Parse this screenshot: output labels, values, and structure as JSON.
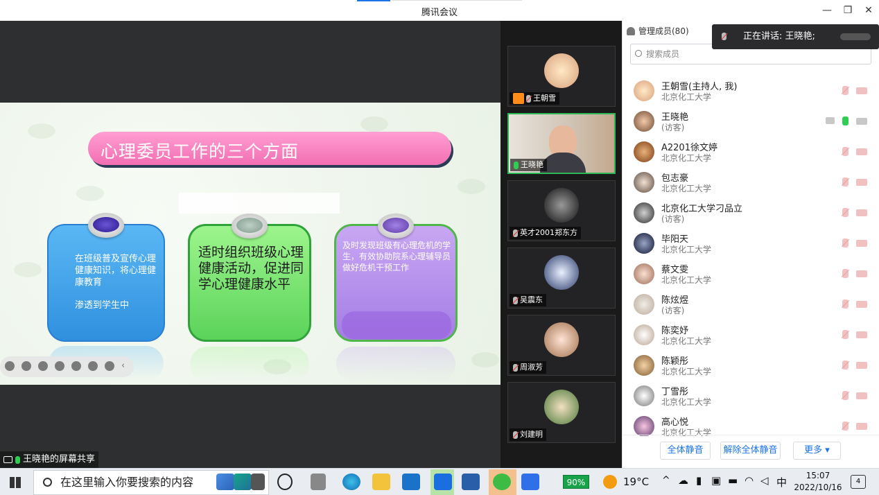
{
  "window": {
    "title": "腾讯会议"
  },
  "slide": {
    "title": "心理委员工作的三个方面",
    "card1_text": "在班级普及宣传心理健康知识，将心理健康教育",
    "card1_text2": "渗透到学生中",
    "card2_text": "适时组织班级心理健康活动，促进同学心理健康水平",
    "card3_text": "及时发现班级有心理危机的学生，有效协助院系心理辅导员做好危机干预工作"
  },
  "screen_share_label": "王晓艳的屏幕共享",
  "video_tiles": [
    {
      "name": "王朝雪",
      "host": true,
      "mic": "muted"
    },
    {
      "name": "王晓艳",
      "host": false,
      "mic": "on",
      "active": true
    },
    {
      "name": "英才2001郑东方",
      "host": false,
      "mic": "muted"
    },
    {
      "name": "吴震东",
      "host": false,
      "mic": "muted"
    },
    {
      "name": "周淑芳",
      "host": false,
      "mic": "muted"
    },
    {
      "name": "刘建明",
      "host": false,
      "mic": "muted"
    }
  ],
  "panel": {
    "title": "管理成员(80)",
    "search_placeholder": "搜索成员",
    "speaking": "正在讲话: 王晓艳;",
    "members": [
      {
        "name": "王朝雪(主持人, 我)",
        "org": "北京化工大学"
      },
      {
        "name": "王晓艳",
        "org": "(访客)"
      },
      {
        "name": "A2201徐文婷",
        "org": "北京化工大学"
      },
      {
        "name": "包志豪",
        "org": "北京化工大学"
      },
      {
        "name": "北京化工大学刁品立",
        "org": "(访客)"
      },
      {
        "name": "毕阳天",
        "org": "北京化工大学"
      },
      {
        "name": "蔡文雯",
        "org": "北京化工大学"
      },
      {
        "name": "陈炫煜",
        "org": "(访客)"
      },
      {
        "name": "陈奕妤",
        "org": "北京化工大学"
      },
      {
        "name": "陈颖彤",
        "org": "北京化工大学"
      },
      {
        "name": "丁雪彤",
        "org": "北京化工大学"
      },
      {
        "name": "高心悦",
        "org": "北京化工大学"
      }
    ],
    "mute_all": "全体静音",
    "unmute_all": "解除全体静音",
    "more": "更多 ▾"
  },
  "taskbar": {
    "search_placeholder": "在这里输入你要搜索的内容",
    "battery": "90%",
    "weather": "19°C",
    "ime": "中",
    "time": "15:07",
    "date": "2022/10/16",
    "notifications": "4"
  },
  "colors": {
    "accent": "#1a73e8",
    "active_green": "#2fb655",
    "banner_pink": "#f26fb3"
  }
}
